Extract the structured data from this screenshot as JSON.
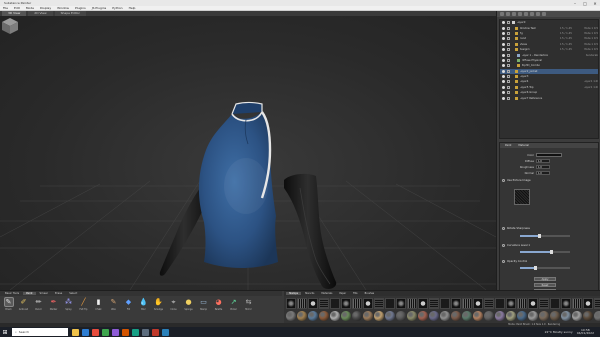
{
  "window": {
    "title": "Substance Painter",
    "controls": [
      "–",
      "□",
      "✕"
    ]
  },
  "menu": [
    "File",
    "Edit",
    "Mode",
    "Display",
    "Window",
    "Plugins",
    "JS Plugins",
    "Python",
    "Help"
  ],
  "doc_tabs": [
    {
      "label": "3D View",
      "active": true
    },
    {
      "label": "2D View",
      "active": false
    },
    {
      "label": "Shape Editor",
      "active": false
    }
  ],
  "scene": {
    "toolbar_icons": 8,
    "rows": [
      {
        "name": "Layer0",
        "col": "",
        "col2": "",
        "selected": false,
        "icon_color": "#d0d0d0"
      },
      {
        "name": "Window Test",
        "col": "0.5 / 1.45",
        "col2": "Mode 1 0.5",
        "selected": false,
        "icon_color": "#c9a23a"
      },
      {
        "name": "fig",
        "col": "0.5 / 1.45",
        "col2": "Mode 1 0.5",
        "selected": false,
        "icon_color": "#c9a23a"
      },
      {
        "name": "hand",
        "col": "0.5 / 1.45",
        "col2": "Mode 1 0.5",
        "selected": false,
        "icon_color": "#c9a23a"
      },
      {
        "name": "shoes",
        "col": "0.5 / 1.45",
        "col2": "Mode 1 0.5",
        "selected": false,
        "icon_color": "#c9a23a"
      },
      {
        "name": "design1",
        "col": "0.5 / 1.45",
        "col2": "Mode 1 0.5",
        "selected": false,
        "icon_color": "#c9a23a"
      },
      {
        "name": "Layer 1 – Renderbox",
        "col": "",
        "col2": "Renderable 1.45",
        "selected": false,
        "icon_color": "#8fa8c8"
      },
      {
        "name": "Diffuse Physical",
        "col": "",
        "col2": "",
        "selected": false,
        "icon_color": "#7ab36a"
      },
      {
        "name": "Top3D_Combo",
        "col": "",
        "col2": "",
        "selected": false,
        "icon_color": "#c9a23a"
      },
      {
        "name": "Layer2_jacket",
        "col": "",
        "col2": "",
        "selected": true,
        "icon_color": "#c9a23a"
      },
      {
        "name": "Layer3",
        "col": "",
        "col2": "",
        "selected": false,
        "icon_color": "#c9a23a"
      },
      {
        "name": "Layer4",
        "col": "",
        "col2": "Layer1  1.00",
        "selected": false,
        "icon_color": "#c9a23a"
      },
      {
        "name": "Layer5 Top",
        "col": "",
        "col2": "Layer1  1.00",
        "selected": false,
        "icon_color": "#c9a23a"
      },
      {
        "name": "Layer6 Group",
        "col": "",
        "col2": "",
        "selected": false,
        "icon_color": "#c9a23a"
      },
      {
        "name": "Layer7 Reference",
        "col": "",
        "col2": "",
        "selected": false,
        "icon_color": "#c9a23a"
      }
    ]
  },
  "properties": {
    "tabs": [
      "Paint",
      "Material"
    ],
    "fields": [
      {
        "label": "Color",
        "value": ""
      },
      {
        "label": "Diffuse",
        "value": "1.0"
      },
      {
        "label": "Roughness",
        "value": "1.0"
      },
      {
        "label": "Normal",
        "value": "1.0"
      }
    ],
    "sections": [
      {
        "label": "Use Picture Image"
      },
      {
        "label": "Rotate Sharpness"
      },
      {
        "label": "Curvature Level 1"
      },
      {
        "label": "Opacity Control"
      }
    ],
    "slider_values": [
      0.38,
      0.62,
      0.3
    ],
    "buttons": [
      "Apply",
      "Reset",
      "Fill"
    ]
  },
  "tool_tabs": [
    {
      "label": "Basic Tools",
      "active": false
    },
    {
      "label": "Paint",
      "active": true
    },
    {
      "label": "Smear",
      "active": false
    },
    {
      "label": "Erase",
      "active": false
    },
    {
      "label": "Select",
      "active": false
    }
  ],
  "tools": [
    {
      "label": "Brush",
      "glyph": "✎",
      "active": true
    },
    {
      "label": "Airbrush",
      "glyph": "✐",
      "active": false
    },
    {
      "label": "Pencil",
      "glyph": "✏",
      "active": false
    },
    {
      "label": "Marker",
      "glyph": "✒",
      "active": false
    },
    {
      "label": "Spray",
      "glyph": "⁂",
      "active": false
    },
    {
      "label": "Felt Tip",
      "glyph": "╱",
      "active": false
    },
    {
      "label": "Chalk",
      "glyph": "▮",
      "active": false
    },
    {
      "label": "Wax",
      "glyph": "✎",
      "active": false
    },
    {
      "label": "Fill",
      "glyph": "◆",
      "active": false
    },
    {
      "label": "Blur",
      "glyph": "💧",
      "active": false
    },
    {
      "label": "Smudge",
      "glyph": "✋",
      "active": false
    },
    {
      "label": "Clone",
      "glyph": "⌖",
      "active": false
    },
    {
      "label": "Sponge",
      "glyph": "●",
      "active": false
    },
    {
      "label": "Stamp",
      "glyph": "▭",
      "active": false
    },
    {
      "label": "Palette",
      "glyph": "◕",
      "active": false
    },
    {
      "label": "Picker",
      "glyph": "↗",
      "active": false
    },
    {
      "label": "Mirror",
      "glyph": "⇆",
      "active": false
    }
  ],
  "stamp_tabs": [
    {
      "label": "Stamps",
      "active": true
    },
    {
      "label": "Stencils",
      "active": false
    },
    {
      "label": "Materials",
      "active": false
    },
    {
      "label": "Paper",
      "active": false
    },
    {
      "label": "Fills",
      "active": false
    },
    {
      "label": "Brushes",
      "active": false
    }
  ],
  "stamp_count": 30,
  "materials": [
    "#7a7a7a",
    "#a08050",
    "#5a7a9a",
    "#8a5a3a",
    "#b0b0b0",
    "#6a8a5a",
    "#4a4a4a",
    "#9a7a5a",
    "#c0a070",
    "#707890",
    "#5a5a5a",
    "#8a8a6a",
    "#a06050",
    "#6a6a8a",
    "#909090",
    "#7a5a4a",
    "#5a7a6a",
    "#b08060",
    "#606060",
    "#8a7aa0",
    "#a0a080",
    "#4a6a8a",
    "#9a9a9a",
    "#7a6a5a",
    "#6a5a4a",
    "#8090a0",
    "#a0a0a0",
    "#5a4a3a",
    "#707070"
  ],
  "statusbar": {
    "text": "Mode: Paint   Brush: 1.0   Size 1.0   ·   Rendering"
  },
  "taskbar": {
    "search_placeholder": "Search",
    "apps": [
      "#f0c24a",
      "#2d7dd2",
      "#e74c3c",
      "#3ea64e",
      "#8e5bd6",
      "#d35400",
      "#16a085",
      "#5d6d7e",
      "#c0392b",
      "#2980b9"
    ],
    "weather": "22°C Mostly sunny",
    "time": "10:58",
    "date": "04/01/2022"
  }
}
